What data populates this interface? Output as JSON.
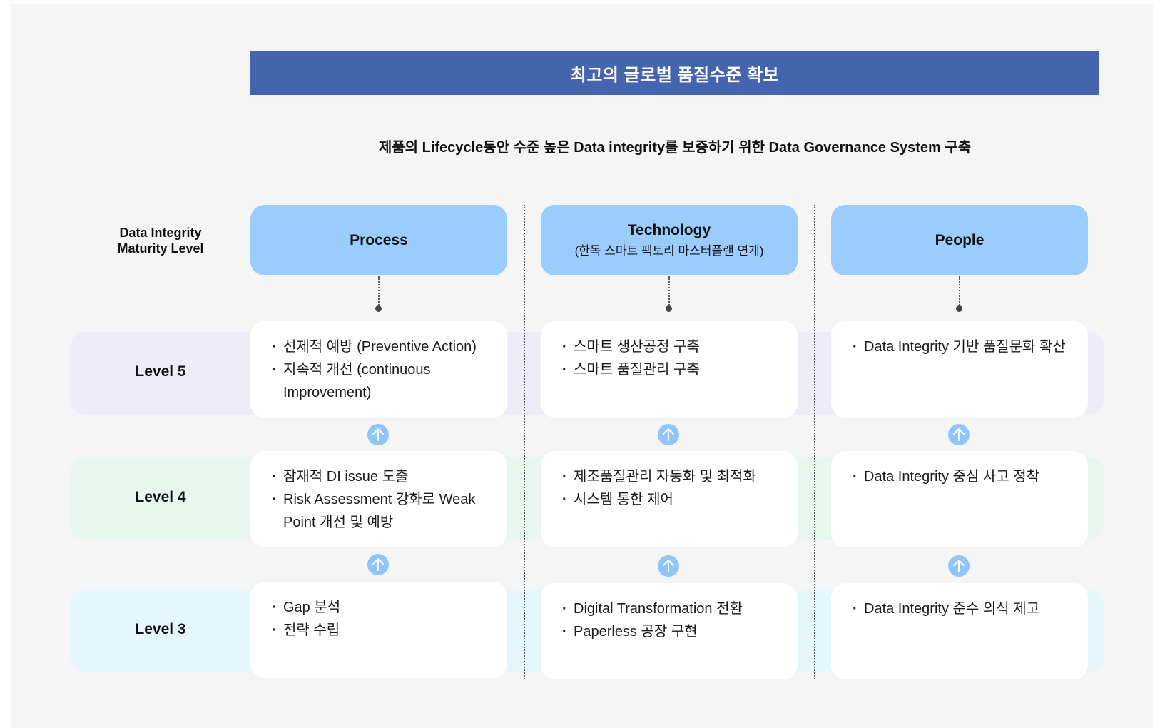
{
  "banner": "최고의 글로벌 품질수준 확보",
  "subtitle": "제품의 Lifecycle동안 수준 높은 Data integrity를 보증하기 위한 Data Governance System 구축",
  "maturity_label": [
    "Data Integrity",
    "Maturity Level"
  ],
  "levels": [
    "Level 5",
    "Level 4",
    "Level 3"
  ],
  "columns": [
    {
      "title": "Process",
      "subtitle": "",
      "cells": [
        [
          "선제적 예방 (Preventive Action)",
          "지속적 개선 (continuous Improvement)"
        ],
        [
          "잠재적 DI issue 도출",
          "Risk Assessment 강화로 Weak Point 개선 및 예방"
        ],
        [
          "Gap 분석",
          "전략 수립"
        ]
      ]
    },
    {
      "title": "Technology",
      "subtitle": "(한독 스마트 팩토리 마스터플랜 연계)",
      "cells": [
        [
          "스마트 생산공정 구축",
          "스마트 품질관리 구축"
        ],
        [
          "제조품질관리 자동화 및 최적화",
          "시스템 통한 제어"
        ],
        [
          "Digital Transformation 전환",
          "Paperless 공장 구현"
        ]
      ]
    },
    {
      "title": "People",
      "subtitle": "",
      "cells": [
        [
          "Data Integrity 기반 품질문화 확산"
        ],
        [
          "Data Integrity 중심 사고 정착"
        ],
        [
          "Data Integrity 준수 의식 제고"
        ]
      ]
    }
  ],
  "colors": {
    "banner": "#4564ae",
    "column_header": "#9accfd",
    "level5_band": "#efecfa",
    "level4_band": "#e7f6ee",
    "level3_band": "#e6f6fd",
    "arrow": "#8ec6fa"
  },
  "icons": [
    "arrow-up-circle-icon"
  ]
}
